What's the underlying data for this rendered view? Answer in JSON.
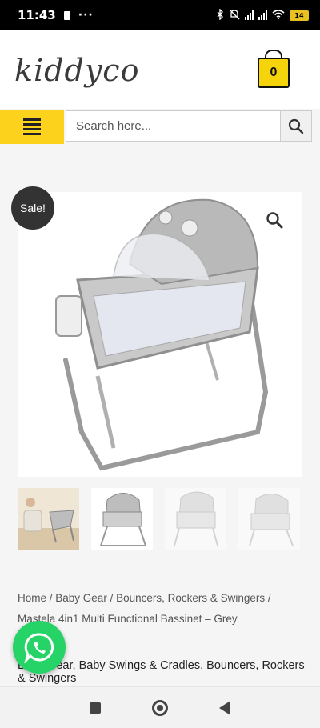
{
  "status_bar": {
    "time": "11:43",
    "more": "···",
    "battery": "14"
  },
  "header": {
    "logo_text": "kiddyco",
    "cart_count": "0"
  },
  "search": {
    "placeholder": "Search here..."
  },
  "product": {
    "sale_badge": "Sale!",
    "gallery_count": 4
  },
  "breadcrumb": {
    "items": [
      "Home",
      "Baby Gear",
      "Bouncers, Rockers & Swingers"
    ],
    "separator": " / ",
    "current": "Mastela 4in1 Multi Functional Bassinet – Grey"
  },
  "categories": {
    "text": "Baby Gear, Baby Swings & Cradles, Bouncers, Rockers & Swingers"
  },
  "colors": {
    "accent": "#fcd21c",
    "whatsapp": "#25d366",
    "badge": "#333333"
  },
  "icons": [
    "bag-icon",
    "hamburger-icon",
    "search-icon",
    "zoom-icon",
    "whatsapp-icon",
    "recents-icon",
    "home-icon",
    "back-icon"
  ]
}
